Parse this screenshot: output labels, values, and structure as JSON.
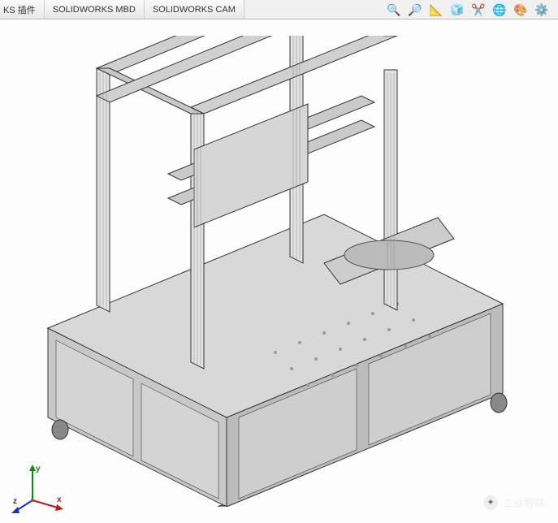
{
  "tabs": {
    "t0": "KS 插件",
    "t1": "SOLIDWORKS MBD",
    "t2": "SOLIDWORKS CAM"
  },
  "triad": {
    "x": "x",
    "y": "y",
    "z": "z"
  },
  "watermark": {
    "label": "工业智联"
  }
}
